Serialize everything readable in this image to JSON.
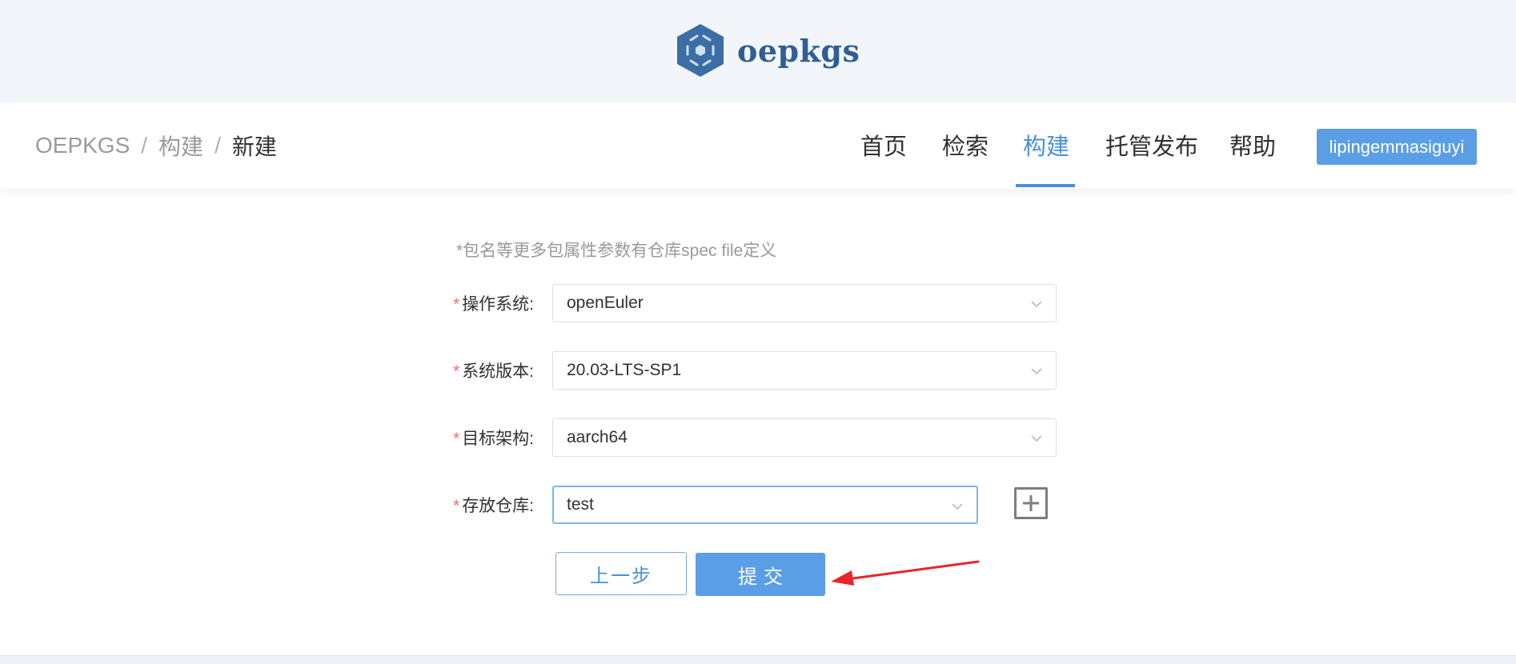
{
  "brand": {
    "name": "oepkgs",
    "logo_icon": "oepkgs-hexagon-logo"
  },
  "breadcrumb": [
    "OEPKGS",
    "构建",
    "新建"
  ],
  "breadcrumb_separator": "/",
  "nav": {
    "items": [
      "首页",
      "检索",
      "构建",
      "托管发布",
      "帮助"
    ],
    "active": "构建",
    "user": "lipingemmasiguyi"
  },
  "form": {
    "hint": "*包名等更多包属性参数有仓库spec file定义",
    "required_mark": "*",
    "fields": [
      {
        "label": "操作系统:",
        "value": "openEuler"
      },
      {
        "label": "系统版本:",
        "value": "20.03-LTS-SP1"
      },
      {
        "label": "目标架构:",
        "value": "aarch64"
      },
      {
        "label": "存放仓库:",
        "value": "test"
      }
    ],
    "add_icon": "plus-square-icon",
    "prev_label": "上一步",
    "submit_label": "提交"
  },
  "colors": {
    "accent": "#4a90d9",
    "button": "#5a9ee6",
    "required": "#f56c6c",
    "annotation_arrow": "#e8262b",
    "banner_bg": "#f2f5f9"
  }
}
